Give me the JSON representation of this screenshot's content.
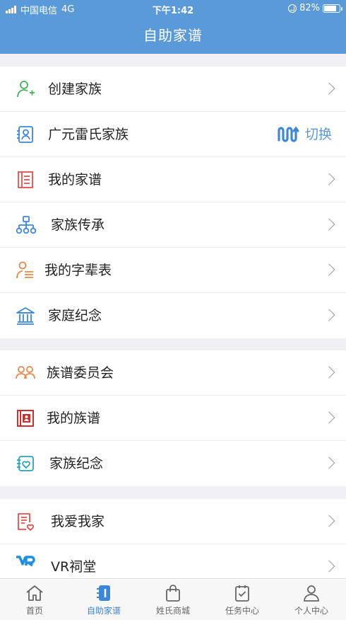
{
  "status_bar": {
    "carrier": "中国电信",
    "network": "4G",
    "time": "下午1:42",
    "battery_pct": "82%",
    "battery_level": 0.82
  },
  "header": {
    "title": "自助家谱"
  },
  "menu_groups": [
    {
      "items": [
        {
          "label": "创建家族",
          "icon": "person-add-icon"
        },
        {
          "label": "广元雷氏家族",
          "icon": "id-card-icon",
          "action": "切换"
        },
        {
          "label": "我的家谱",
          "icon": "book-icon"
        },
        {
          "label": "家族传承",
          "icon": "tree-icon"
        },
        {
          "label": "我的字辈表",
          "icon": "person-list-icon"
        },
        {
          "label": "家庭纪念",
          "icon": "temple-icon"
        }
      ]
    },
    {
      "items": [
        {
          "label": "族谱委员会",
          "icon": "group-icon"
        },
        {
          "label": "我的族谱",
          "icon": "album-icon"
        },
        {
          "label": "家族纪念",
          "icon": "heart-card-icon"
        }
      ]
    },
    {
      "items": [
        {
          "label": "我爱我家",
          "icon": "document-heart-icon"
        },
        {
          "label": "VR祠堂",
          "icon": "vr-icon"
        }
      ]
    }
  ],
  "tabbar": [
    {
      "label": "首页",
      "icon": "home-icon"
    },
    {
      "label": "自助家谱",
      "icon": "genealogy-icon",
      "active": true
    },
    {
      "label": "姓氏商城",
      "icon": "shopping-bag-icon"
    },
    {
      "label": "任务中心",
      "icon": "task-icon"
    },
    {
      "label": "个人中心",
      "icon": "user-icon"
    }
  ],
  "colors": {
    "primary": "#5b9ad9",
    "active_tab": "#3d87d8",
    "background": "#efeff4",
    "green_icon": "#3fb55a",
    "red_icon": "#e0504a",
    "orange_icon": "#e8894a"
  }
}
